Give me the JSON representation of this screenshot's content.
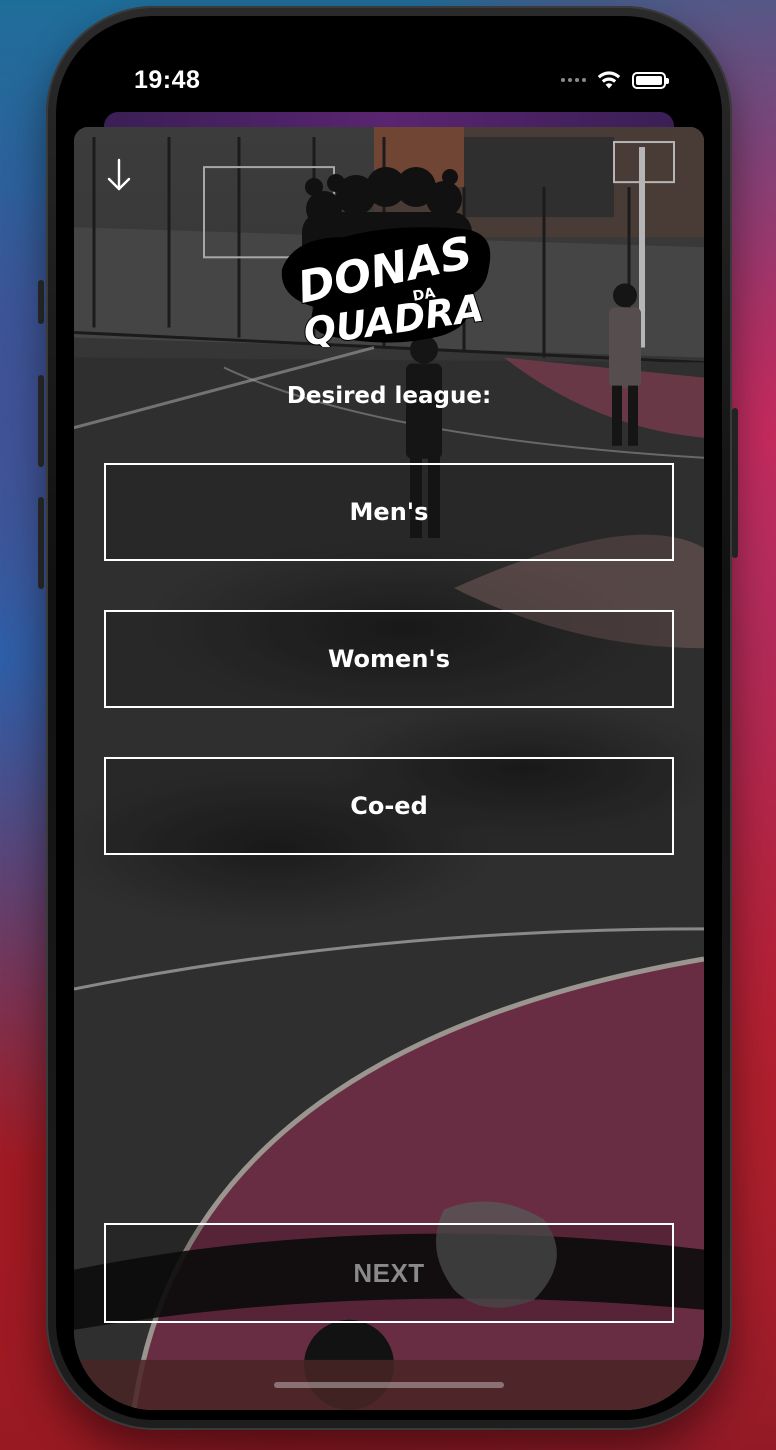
{
  "status_bar": {
    "time": "19:48",
    "wifi_icon": "wifi-icon",
    "battery_icon": "battery-icon",
    "signal_icon": "cellular-signal-icon"
  },
  "header": {
    "close_icon": "arrow-down-icon",
    "logo_text_line1": "DONAS",
    "logo_text_small": "DA",
    "logo_text_line2": "QUADRA"
  },
  "form": {
    "question": "Desired league:",
    "options": [
      {
        "label": "Men's"
      },
      {
        "label": "Women's"
      },
      {
        "label": "Co-ed"
      }
    ],
    "next_label": "NEXT"
  },
  "colors": {
    "accent_court_pink": "#b24466",
    "text": "#ffffff",
    "disabled_text": "#8a8a8a"
  }
}
